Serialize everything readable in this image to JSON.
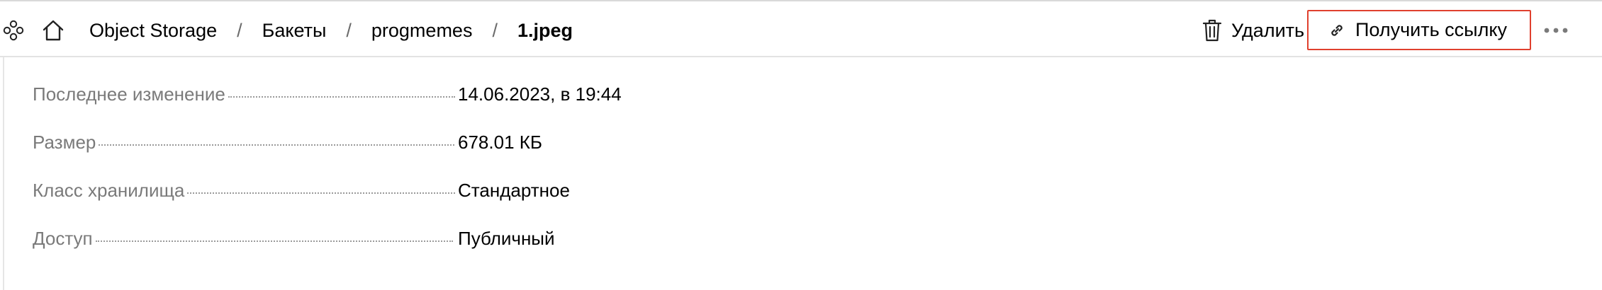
{
  "header": {
    "breadcrumb": {
      "items": [
        "Object Storage",
        "Бакеты",
        "progmemes"
      ],
      "current": "1.jpeg",
      "separator": "/"
    },
    "actions": {
      "delete_label": "Удалить",
      "get_link_label": "Получить ссылку"
    },
    "icons": {
      "services": "services-grid-icon",
      "home": "home-icon",
      "delete": "trash-icon",
      "link": "link-icon",
      "more": "more-horizontal-icon"
    }
  },
  "properties": [
    {
      "label": "Последнее изменение",
      "value": "14.06.2023, в 19:44"
    },
    {
      "label": "Размер",
      "value": "678.01 КБ"
    },
    {
      "label": "Класс хранилища",
      "value": "Стандартное"
    },
    {
      "label": "Доступ",
      "value": "Публичный"
    }
  ],
  "colors": {
    "highlight_border": "#e0402e",
    "label_text": "#7a7a7a",
    "value_text": "#000000",
    "divider": "#e3e3e3"
  }
}
